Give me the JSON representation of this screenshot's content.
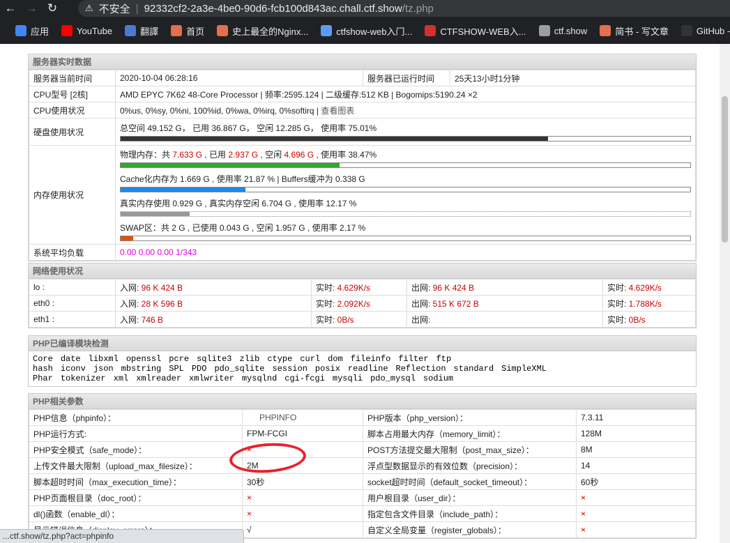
{
  "browser": {
    "insecure_label": "不安全",
    "url_host": "92332cf2-2a3e-4be0-90d6-fcb100d843ac.chall.ctf.show",
    "url_path": "/tz.php",
    "bookmarks": [
      {
        "icon": "apps-icon",
        "label": "应用",
        "color": "#4285f4"
      },
      {
        "icon": "youtube-icon",
        "label": "YouTube",
        "color": "#ff0000"
      },
      {
        "icon": "translate-icon",
        "label": "翻譯",
        "color": "#4a7bd0"
      },
      {
        "icon": "jianshu-icon",
        "label": "首页",
        "color": "#e36f4e"
      },
      {
        "icon": "jianshu-icon",
        "label": "史上最全的Nginx...",
        "color": "#e36f4e"
      },
      {
        "icon": "cloud-icon",
        "label": "ctfshow-web入门...",
        "color": "#5b9cf6"
      },
      {
        "icon": "ctfshow-icon",
        "label": "CTFSHOW-WEB入...",
        "color": "#d32f2f"
      },
      {
        "icon": "globe-icon",
        "label": "ctf.show",
        "color": "#9e9e9e"
      },
      {
        "icon": "jianshu-icon",
        "label": "简书 - 写文章",
        "color": "#e36f4e"
      },
      {
        "icon": "github-icon",
        "label": "GitHub - T",
        "color": "#333333"
      }
    ]
  },
  "server": {
    "title": "服务器实时数据",
    "time_label": "服务器当前时间",
    "time_value": "2020-10-04 06:28:16",
    "uptime_label": "服务器已运行时间",
    "uptime_value": "25天13小时1分钟",
    "cpu_label": "CPU型号 [2核]",
    "cpu_value": "AMD EPYC 7K62 48-Core Processor | 频率:2595.124 | 二级缓存:512 KB | Bogomips:5190.24 ×2",
    "cpu_usage_label": "CPU使用状况",
    "cpu_usage_value": "0%us, 0%sy, 0%ni, 100%id, 0%wa, 0%irq, 0%softirq |",
    "cpu_chart_link": "查看图表",
    "disk_label": "硬盘使用状况",
    "disk_text": "总空间 49.152 G， 已用 36.867 G， 空闲 12.285 G， 使用率 75.01%",
    "disk_pct": 0.75,
    "mem_label": "内存使用状况",
    "mem_phys": {
      "p1": "物理内存：共 ",
      "total": "7.633 G",
      "p2": " , 已用 ",
      "used": "2.937 G",
      "p3": " , 空闲 ",
      "free": "4.696 G",
      "p4": " , 使用率 38.47%",
      "pct": 0.3847,
      "color": "#2ea92e"
    },
    "mem_cache": {
      "text": "Cache化内存为 1.669 G , 使用率 21.87 % | Buffers缓冲为 0.338 G",
      "pct": 0.2187,
      "color": "#1e88e5"
    },
    "mem_real": {
      "text": "真实内存使用 0.929 G , 真实内存空闲 6.704 G , 使用率 12.17 %",
      "pct": 0.1217,
      "color": "#999999"
    },
    "mem_swap": {
      "text": "SWAP区：共 2 G , 已使用 0.043 G , 空闲 1.957 G , 使用率 2.17 %",
      "pct": 0.0217,
      "color": "#e65100"
    },
    "load_label": "系统平均负载",
    "load_value": "0.00 0.00 0.00 1/343"
  },
  "network": {
    "title": "网络使用状况",
    "rows": [
      {
        "name": "lo :",
        "in_label": "入网: ",
        "in": "96 K 424 B",
        "rt_in_label": "实时: ",
        "rt_in": "4.629K/s",
        "out_label": "出网: ",
        "out": "96 K 424 B",
        "rt_out_label": "实时: ",
        "rt_out": "4.629K/s"
      },
      {
        "name": "eth0 :",
        "in_label": "入网: ",
        "in": "28 K 596 B",
        "rt_in_label": "实时: ",
        "rt_in": "2.092K/s",
        "out_label": "出网: ",
        "out": "515 K 672 B",
        "rt_out_label": "实时: ",
        "rt_out": "1.788K/s"
      },
      {
        "name": "eth1 :",
        "in_label": "入网: ",
        "in": "746 B",
        "rt_in_label": "实时: ",
        "rt_in": "0B/s",
        "out_label": "出网: ",
        "out": "",
        "rt_out_label": "实时: ",
        "rt_out": "0B/s"
      }
    ]
  },
  "modules": {
    "title": "PHP已编译模块检测",
    "lines": [
      [
        "Core",
        "date",
        "libxml",
        "openssl",
        "pcre",
        "sqlite3",
        "zlib",
        "ctype",
        "curl",
        "dom",
        "fileinfo",
        "filter",
        "ftp"
      ],
      [
        "hash",
        "iconv",
        "json",
        "mbstring",
        "SPL",
        "PDO",
        "pdo_sqlite",
        "session",
        "posix",
        "readline",
        "Reflection",
        "standard",
        "SimpleXML"
      ],
      [
        "Phar",
        "tokenizer",
        "xml",
        "xmlreader",
        "xmlwriter",
        "mysqlnd",
        "cgi-fcgi",
        "mysqli",
        "pdo_mysql",
        "sodium"
      ]
    ]
  },
  "php": {
    "title": "PHP相关参数",
    "rows": [
      {
        "l1": "PHP信息（phpinfo）：",
        "v1": "PHPINFO",
        "c1": "link",
        "l2": "PHP版本（php_version）：",
        "v2": "7.3.11",
        "c2": ""
      },
      {
        "l1": "PHP运行方式:",
        "v1": "FPM-FCGI",
        "c1": "",
        "l2": "脚本占用最大内存（memory_limit）：",
        "v2": "128M",
        "c2": ""
      },
      {
        "l1": "PHP安全模式（safe_mode）：",
        "v1": "×",
        "c1": "red",
        "l2": "POST方法提交最大限制（post_max_size）：",
        "v2": "8M",
        "c2": ""
      },
      {
        "l1": "上传文件最大限制（upload_max_filesize）：",
        "v1": "2M",
        "c1": "",
        "l2": "浮点型数据显示的有效位数（precision）：",
        "v2": "14",
        "c2": ""
      },
      {
        "l1": "脚本超时时间（max_execution_time）：",
        "v1": "30秒",
        "c1": "",
        "l2": "socket超时时间（default_socket_timeout）：",
        "v2": "60秒",
        "c2": ""
      },
      {
        "l1": "PHP页面根目录（doc_root）：",
        "v1": "×",
        "c1": "red",
        "l2": "用户根目录（user_dir）：",
        "v2": "×",
        "c2": "red"
      },
      {
        "l1": "dl()函数（enable_dl）：",
        "v1": "×",
        "c1": "red",
        "l2": "指定包含文件目录（include_path）：",
        "v2": "×",
        "c2": "red"
      },
      {
        "l1": "显示错误信息（display_errors）：",
        "v1": "√",
        "c1": "",
        "l2": "自定义全局变量（register_globals）：",
        "v2": "×",
        "c2": "red"
      }
    ]
  },
  "status_bar": "...ctf.show/tz.php?act=phpinfo"
}
